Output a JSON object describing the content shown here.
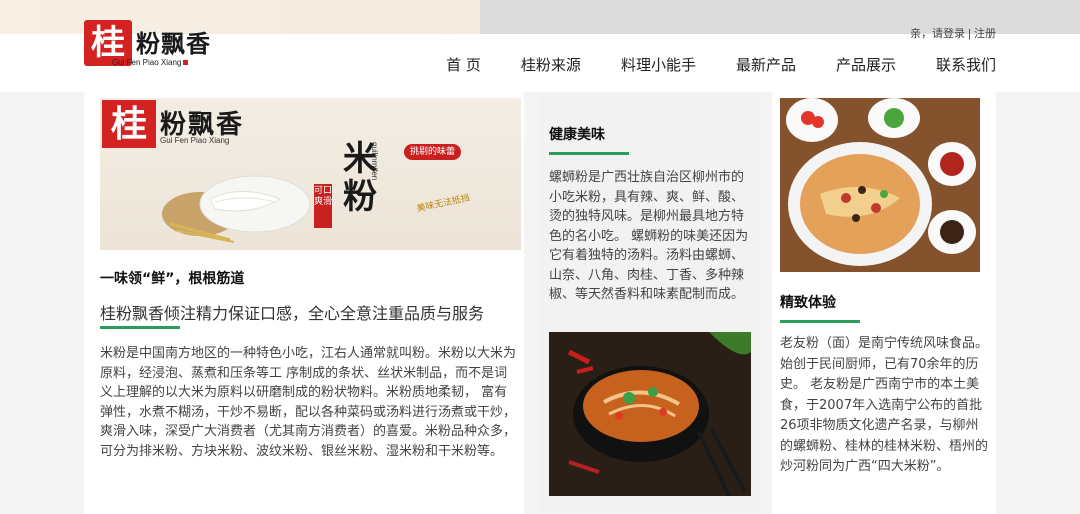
{
  "brand": {
    "logo_char": "桂",
    "name": "粉飘香",
    "pinyin": "Gui Fen Piao Xiang"
  },
  "header": {
    "login": "亲，请登录",
    "separator": "|",
    "register": "注册"
  },
  "nav": {
    "items": [
      "首 页",
      "桂粉来源",
      "料理小能手",
      "最新产品",
      "产品展示",
      "联系我们"
    ]
  },
  "banner": {
    "logo_char": "桂",
    "name": "粉飘香",
    "pinyin": "Gui Fen Piao Xiang",
    "big_text": "米粉",
    "vertical_pinyin": "guilinmifen",
    "tag": "挑剔的味蕾",
    "stamp": "可口爽滑",
    "slogan": "美味无法抵挡"
  },
  "left": {
    "heading": "一味领“鲜”，根根筋道",
    "subheading": "桂粉飘香倾注精力保证口感，全心全意注重品质与服务",
    "body": "米粉是中国南方地区的一种特色小吃，江右人通常就叫粉。米粉以大米为原料，经浸泡、蒸煮和压条等工 序制成的条状、丝状米制品，而不是词义上理解的以大米为原料以研磨制成的粉状物料。米粉质地柔韧， 富有弹性，水煮不糊汤，干炒不易断，配以各种菜码或汤料进行汤煮或干炒，爽滑入味，深受广大消费者（尤其南方消费者）的喜爱。米粉品种众多，可分为排米粉、方块米粉、波纹米粉、银丝米粉、湿米粉和干米粉等。"
  },
  "middle": {
    "heading": "健康美味",
    "body": "螺蛳粉是广西壮族自治区柳州市的小吃米粉，具有辣、爽、鲜、酸、烫的独特风味。是柳州最具地方特色的名小吃。 螺蛳粉的味美还因为它有着独特的汤料。汤料由螺蛳、山奈、八角、肉桂、丁香、多种辣椒、等天然香料和味素配制而成。"
  },
  "right": {
    "heading": "精致体验",
    "body": "老友粉（面）是南宁传统风味食品。始创于民间厨师，已有70余年的历史。 老友粉是广西南宁市的本土美食，于2007年入选南宁公布的首批26项非物质文化遗产名录，与柳州的螺蛳粉、桂林的桂林米粉、梧州的炒河粉同为广西“四大米粉”。"
  },
  "colors": {
    "accent_green": "#2a9d5c",
    "brand_red": "#d42121"
  }
}
